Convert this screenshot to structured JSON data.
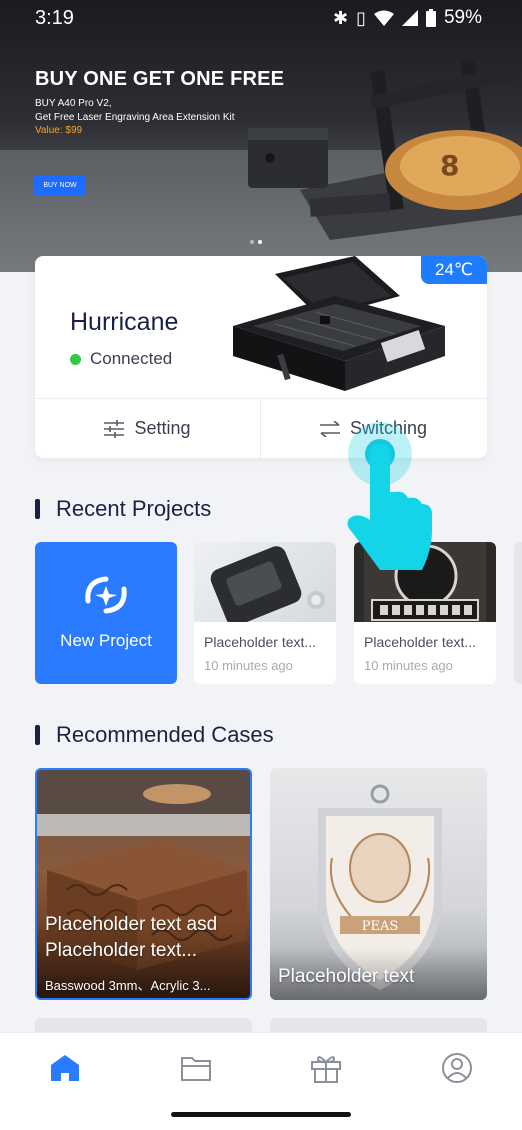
{
  "status_bar": {
    "time": "3:19",
    "battery": "59%"
  },
  "banner": {
    "title": "BUY ONE GET ONE FREE",
    "subtitle": "BUY A40 Pro V2,\nGet Free Laser Engraving Area Extension Kit",
    "value": "Value: $99",
    "cta": "BUY NOW"
  },
  "device": {
    "temperature": "24℃",
    "name": "Hurricane",
    "status": "Connected",
    "status_color": "#2ecc40",
    "setting_label": "Setting",
    "switching_label": "Switching"
  },
  "recent": {
    "title": "Recent Projects",
    "new_project_label": "New Project",
    "projects": [
      {
        "title": "Placeholder text...",
        "time": "10 minutes ago"
      },
      {
        "title": "Placeholder text...",
        "time": "10 minutes ago"
      }
    ]
  },
  "recommended": {
    "title": "Recommended Cases",
    "cases": [
      {
        "title": "Placeholder text asd\nPlaceholder text...",
        "materials": "Basswood 3mm、Acrylic 3..."
      },
      {
        "title": "Placeholder text"
      }
    ]
  },
  "nav": {
    "items": [
      {
        "icon": "home-icon",
        "active": true
      },
      {
        "icon": "folder-icon",
        "active": false
      },
      {
        "icon": "gift-icon",
        "active": false
      },
      {
        "icon": "profile-icon",
        "active": false
      }
    ]
  },
  "colors": {
    "accent": "#2a7bff",
    "active_nav": "#2a7bff",
    "inactive_nav": "#8c909c"
  }
}
